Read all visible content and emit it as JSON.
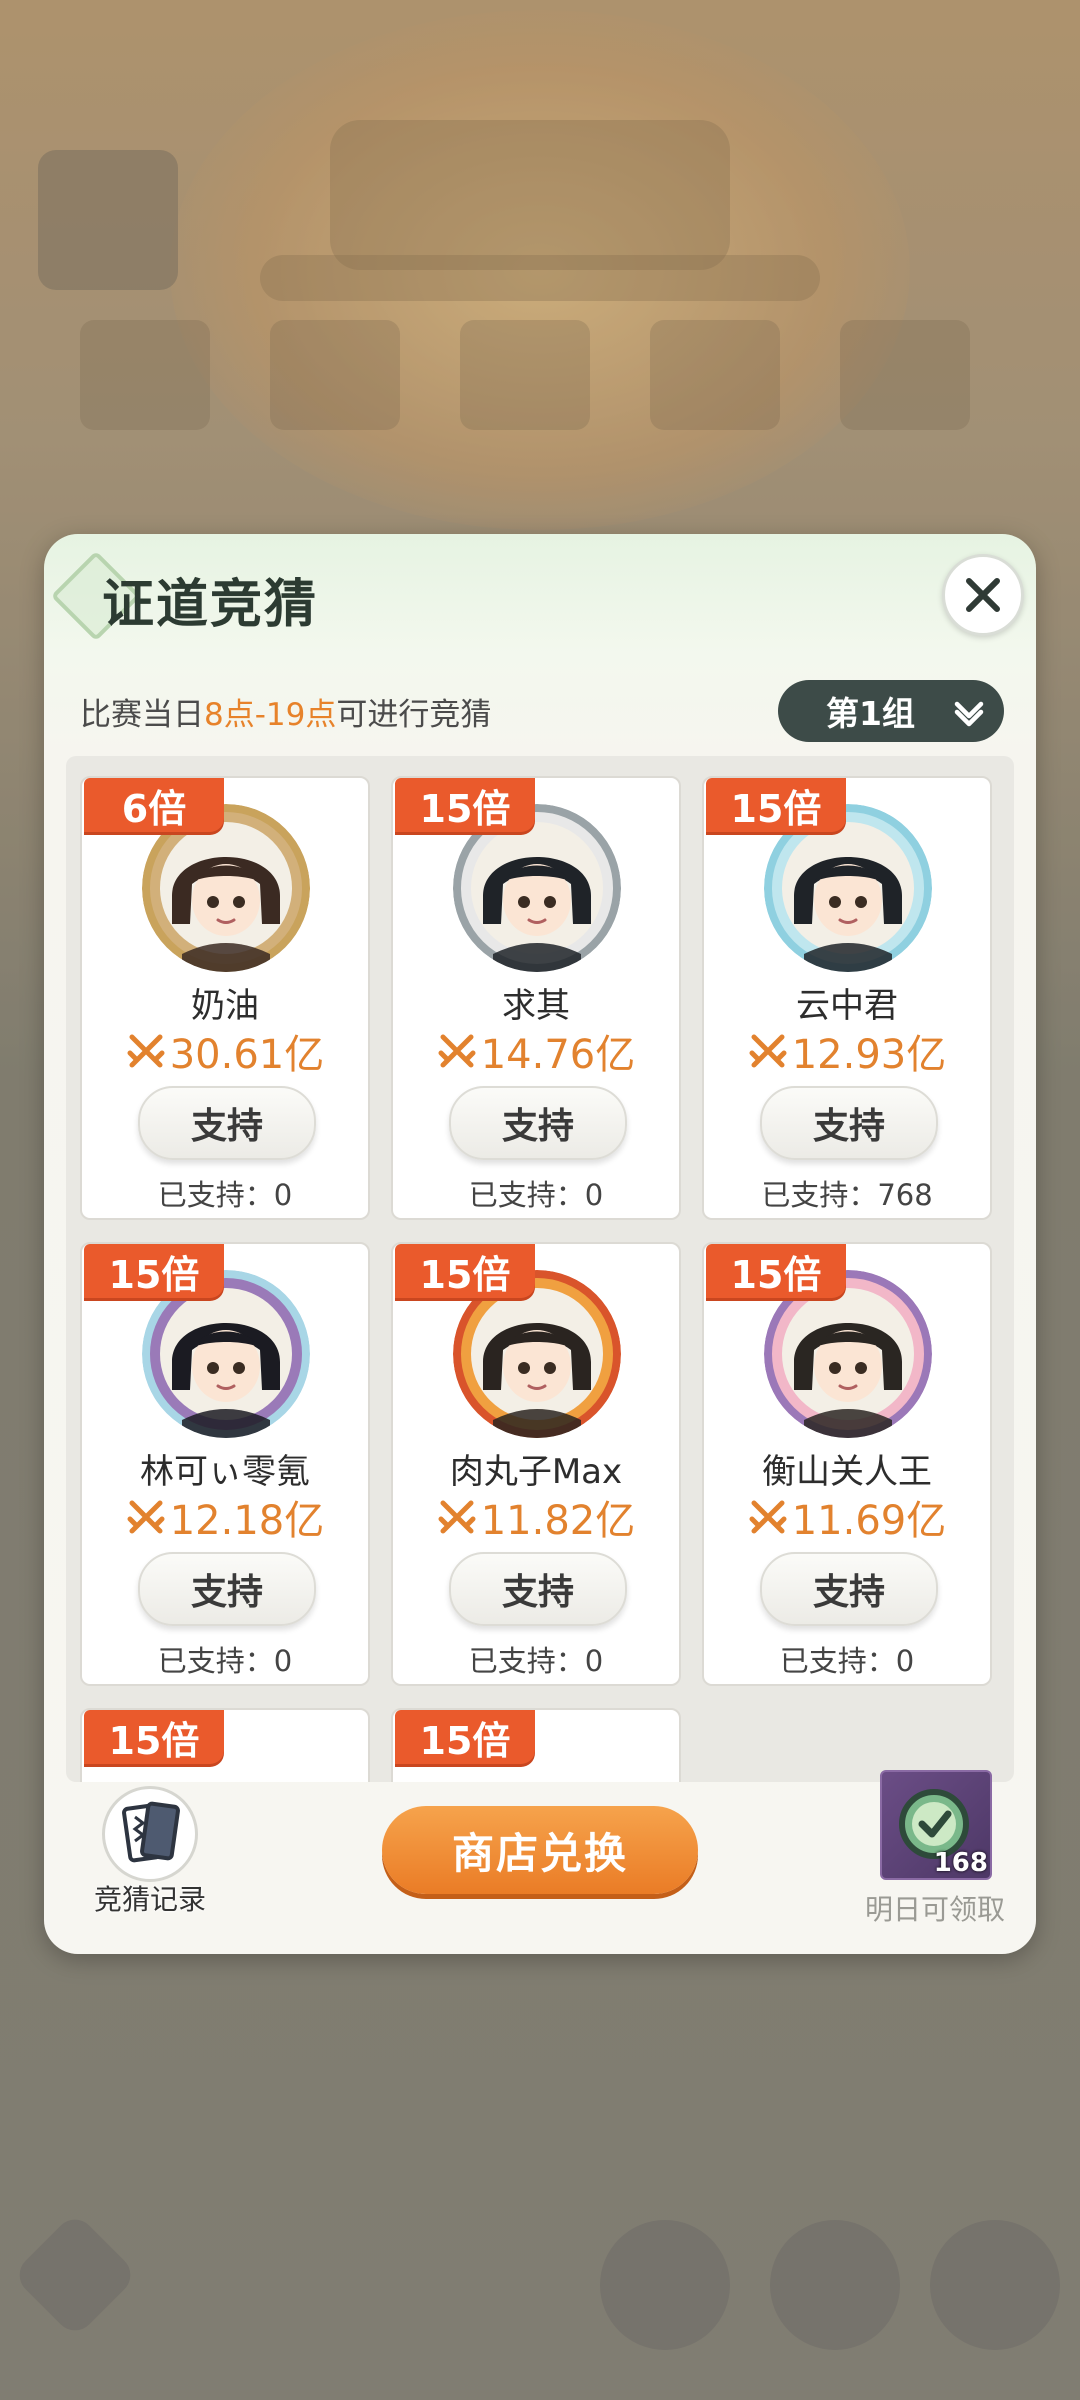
{
  "modal": {
    "title": "证道竞猜",
    "notice": {
      "prefix": "比赛当日",
      "highlight": "8点-19点",
      "suffix": "可进行竞猜"
    },
    "group_select": "第1组"
  },
  "contestants": [
    {
      "multiplier": "6倍",
      "name": "奶油",
      "power": "30.61亿",
      "support_label": "支持",
      "supported": "已支持：0",
      "ring": "#c9a35c",
      "hair": "#3b2a22",
      "accent": "#d2b07a"
    },
    {
      "multiplier": "15倍",
      "name": "求其",
      "power": "14.76亿",
      "support_label": "支持",
      "supported": "已支持：0",
      "ring": "#9aa3a7",
      "hair": "#1f2328",
      "accent": "#e8e8e8"
    },
    {
      "multiplier": "15倍",
      "name": "云中君",
      "power": "12.93亿",
      "support_label": "支持",
      "supported": "已支持：768",
      "ring": "#8fd0e0",
      "hair": "#1f2328",
      "accent": "#bfe6ee"
    },
    {
      "multiplier": "15倍",
      "name": "林可ぃ零氪",
      "power": "12.18亿",
      "support_label": "支持",
      "supported": "已支持：0",
      "ring": "#a8d6e6",
      "hair": "#1b1b22",
      "accent": "#9a7ab8"
    },
    {
      "multiplier": "15倍",
      "name": "肉丸子Max",
      "power": "11.82亿",
      "support_label": "支持",
      "supported": "已支持：0",
      "ring": "#d9542b",
      "hair": "#2a2420",
      "accent": "#f0a040"
    },
    {
      "multiplier": "15倍",
      "name": "衡山关人王",
      "power": "11.69亿",
      "support_label": "支持",
      "supported": "已支持：0",
      "ring": "#9b78b8",
      "hair": "#2a2622",
      "accent": "#f2b7c8"
    },
    {
      "multiplier": "15倍"
    },
    {
      "multiplier": "15倍"
    }
  ],
  "bottom": {
    "record_label": "竞猜记录",
    "shop_label": "商店兑换",
    "reward_count": "168",
    "reward_label": "明日可领取"
  },
  "icons": {
    "close": "close-icon",
    "chevron": "chevron-down-icon",
    "power": "crossed-swords-icon",
    "record": "cards-icon",
    "reward": "check-badge-icon"
  },
  "colors": {
    "multiplier_bg": "#ea5a2c",
    "power_text": "#e2822e",
    "notice_highlight": "#e7822a",
    "shop_button": "#ea7c26",
    "group_select_bg": "#3d4b48"
  }
}
